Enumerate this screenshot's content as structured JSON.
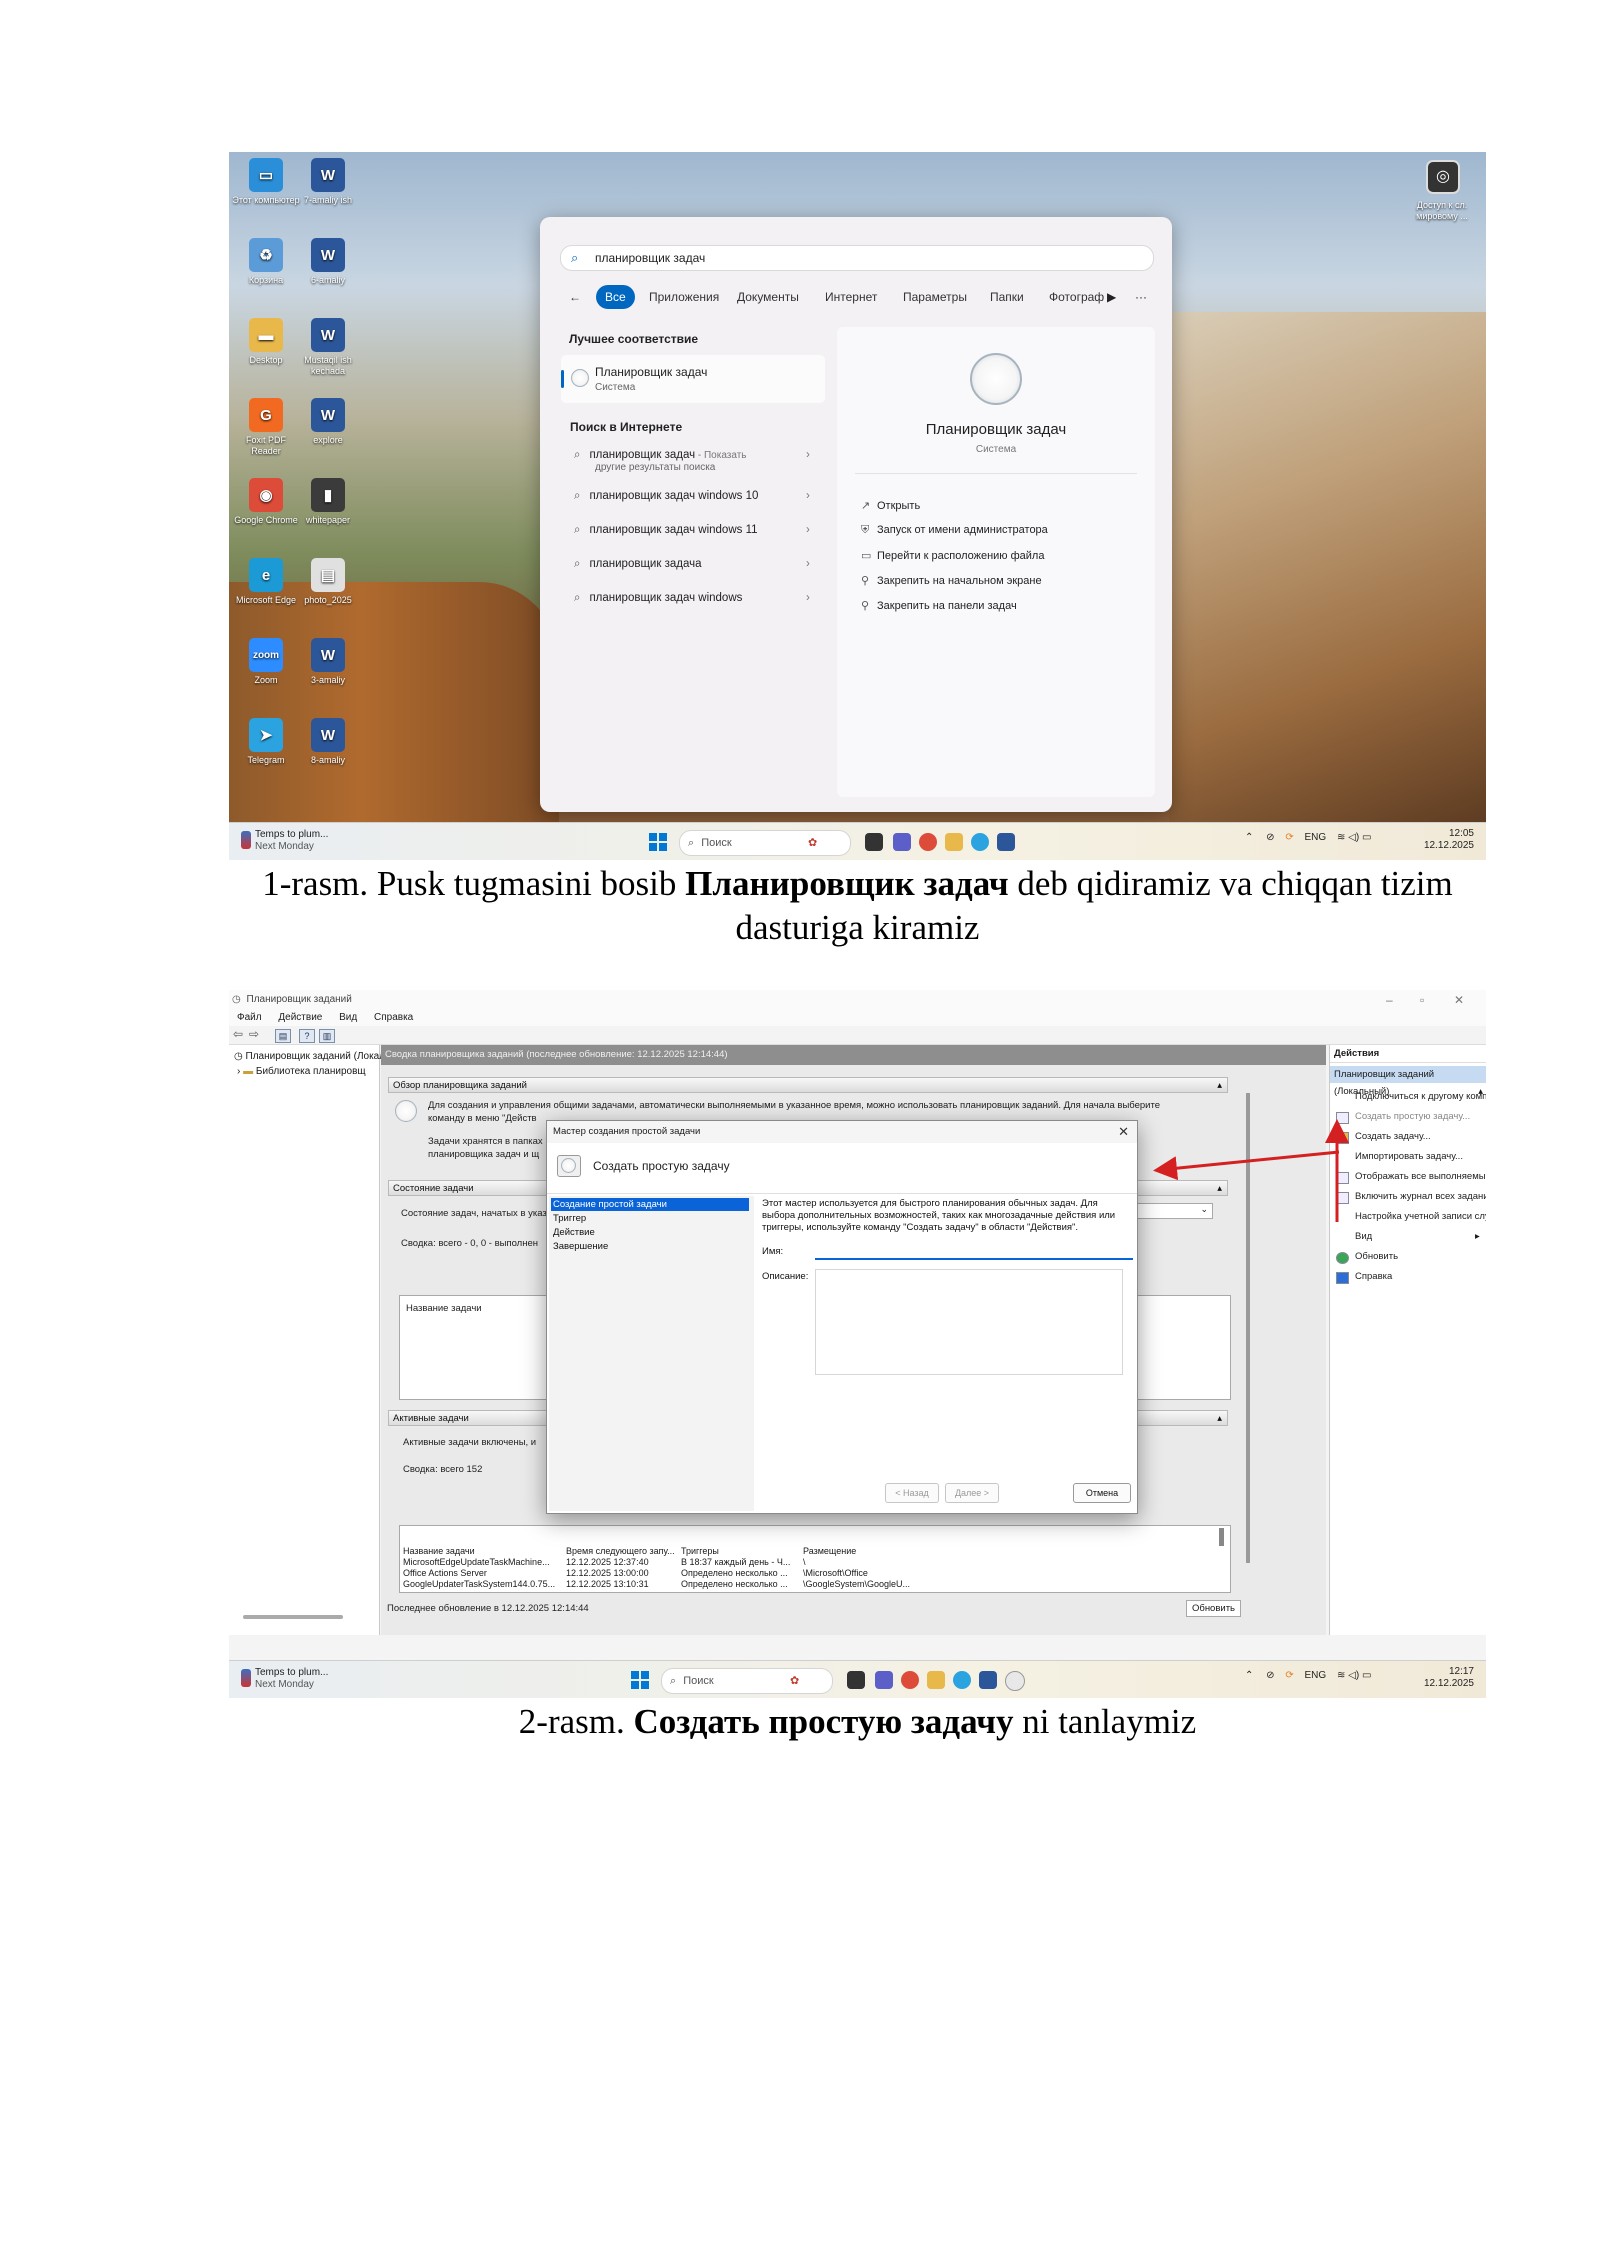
{
  "fig1": {
    "desktop_icons": [
      {
        "label": "Этот компьютер",
        "color": "#2a8fd8",
        "glyph": "▭"
      },
      {
        "label": "7-amaliy ish",
        "color": "#2b579a",
        "glyph": "W"
      },
      {
        "label": "Корзина",
        "color": "#5a9bd8",
        "glyph": "♻"
      },
      {
        "label": "6-amaliy",
        "color": "#2b579a",
        "glyph": "W"
      },
      {
        "label": "Desktop",
        "color": "#e8b84a",
        "glyph": "▬"
      },
      {
        "label": "Mustaqil ish kechada",
        "color": "#2b579a",
        "glyph": "W"
      },
      {
        "label": "Foxit PDF Reader",
        "color": "#f26a22",
        "glyph": "G"
      },
      {
        "label": "explore",
        "color": "#2b579a",
        "glyph": "W"
      },
      {
        "label": "Google Chrome",
        "color": "#dd4b39",
        "glyph": "◉"
      },
      {
        "label": "whitepaper",
        "color": "#3b3b3b",
        "glyph": "▮"
      },
      {
        "label": "Microsoft Edge",
        "color": "#1b9ad6",
        "glyph": "e"
      },
      {
        "label": "photo_2025",
        "color": "#e0e0e0",
        "glyph": "▤"
      },
      {
        "label": "Zoom",
        "color": "#2d8cff",
        "glyph": "zoom"
      },
      {
        "label": "3-amaliy",
        "color": "#2b579a",
        "glyph": "W"
      },
      {
        "label": "Telegram",
        "color": "#2aa3e0",
        "glyph": "➤"
      },
      {
        "label": "8-amaliy",
        "color": "#2b579a",
        "glyph": "W"
      }
    ],
    "top_right_label": "Доступ к сл. мировому ...",
    "search": {
      "query": "планировщик задач",
      "chips": [
        "Все",
        "Приложения",
        "Документы",
        "Интернет",
        "Параметры",
        "Папки",
        "Фотограф"
      ],
      "best_match_heading": "Лучшее соответствие",
      "best_match_title": "Планировщик задач",
      "best_match_sub": "Система",
      "web_heading": "Поиск в Интернете",
      "web_results": [
        {
          "text": "планировщик задач",
          "suffix": " - Показать",
          "line2": "другие результаты поиска"
        },
        {
          "text": "планировщик задач windows 10",
          "suffix": "",
          "line2": ""
        },
        {
          "text": "планировщик задач windows 11",
          "suffix": "",
          "line2": ""
        },
        {
          "text": "планировщик задача",
          "suffix": "",
          "line2": ""
        },
        {
          "text": "планировщик задач windows",
          "suffix": "",
          "line2": ""
        }
      ],
      "app_name": "Планировщик задач",
      "app_sub": "Система",
      "actions": [
        "Открыть",
        "Запуск от имени администратора",
        "Перейти к расположению файла",
        "Закрепить на начальном экране",
        "Закрепить на панели задач"
      ]
    },
    "taskbar": {
      "weather_1": "Temps to plum...",
      "weather_2": "Next Monday",
      "search_label": "Поиск",
      "lang": "ENG",
      "time": "12:05",
      "date": "12.12.2025"
    }
  },
  "caption1": {
    "pre": "1-rasm. Pusk tugmasini bosib ",
    "bold": "Планировщик задач",
    "post": " deb qidiramiz va chiqqan tizim dasturiga kiramiz"
  },
  "fig2": {
    "window_title": "Планировщик заданий",
    "menu": [
      "Файл",
      "Действие",
      "Вид",
      "Справка"
    ],
    "tree": [
      "Планировщик заданий (Локаль",
      "Библиотека планировщ"
    ],
    "center_header": "Сводка планировщика заданий (последнее обновление: 12.12.2025 12:14:44)",
    "sections": {
      "overview": "Обзор планировщика заданий",
      "status": "Состояние задачи",
      "active": "Активные задачи"
    },
    "overview_text_1": "Для создания и управления общими задачами, автоматически выполняемыми в указанное время, можно использовать планировщик заданий. Для начала выберите",
    "overview_text_2": "команду в меню \"Действ",
    "overview_text_3": "Задачи хранятся в папках",
    "overview_text_4": "планировщика задач и щ",
    "status_text": "Состояние задач, начатых в указ",
    "summary_text": "Сводка: всего - 0, 0 - выполнен",
    "task_name_col": "Название задачи",
    "active_text": "Активные задачи включены, и",
    "active_summary": "Сводка: всего 152",
    "table_headers": [
      "Название задачи",
      "Время следующего запу...",
      "Триггеры",
      "Размещение"
    ],
    "table_rows": [
      [
        "MicrosoftEdgeUpdateTaskMachine...",
        "12.12.2025 12:37:40",
        "В 18:37 каждый день - Ч...",
        "\\"
      ],
      [
        "Office Actions Server",
        "12.12.2025 13:00:00",
        "Определено несколько ...",
        "\\Microsoft\\Office"
      ],
      [
        "GoogleUpdaterTaskSystem144.0.75...",
        "12.12.2025 13:10:31",
        "Определено несколько ...",
        "\\GoogleSystem\\GoogleU..."
      ]
    ],
    "last_update": "Последнее обновление в 12.12.2025 12:14:44",
    "refresh_button": "Обновить",
    "actions_header": "Действия",
    "actions_group": "Планировщик заданий (Локальный)",
    "actions_items": [
      "Подключиться к другому компьютеру...",
      "Создать простую задачу...",
      "Создать задачу...",
      "Импортировать задачу...",
      "Отображать все выполняемые задачи",
      "Включить журнал всех заданий",
      "Настройка учетной записи службы AT",
      "Вид",
      "Обновить",
      "Справка"
    ],
    "wizard": {
      "title": "Мастер создания простой задачи",
      "heading": "Создать простую задачу",
      "steps": [
        "Создание простой задачи",
        "Триггер",
        "Действие",
        "Завершение"
      ],
      "description": "Этот мастер используется для быстрого планирования обычных задач.  Для выбора дополнительных возможностей, таких как многозадачные действия или триггеры, используйте команду \"Создать задачу\" в области \"Действия\".",
      "name_label": "Имя:",
      "desc_label": "Описание:",
      "back": "< Назад",
      "next": "Далее >",
      "cancel": "Отмена"
    },
    "taskbar": {
      "weather_1": "Temps to plum...",
      "weather_2": "Next Monday",
      "search_label": "Поиск",
      "lang": "ENG",
      "time": "12:17",
      "date": "12.12.2025"
    },
    "arrow_color": "#d42020"
  },
  "caption2": {
    "pre": "2-rasm. ",
    "bold": "Создать простую задачу",
    "post": " ni tanlaymiz"
  }
}
